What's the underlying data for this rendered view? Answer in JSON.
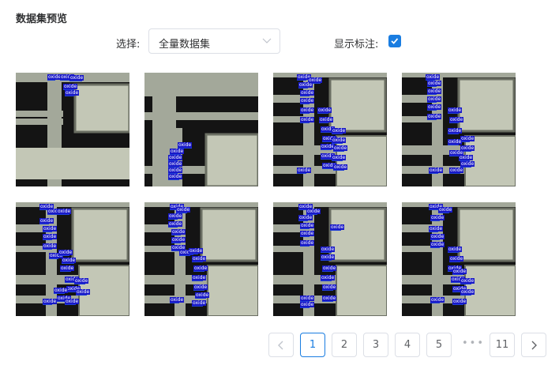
{
  "page": {
    "title": "数据集预览"
  },
  "toolbar": {
    "select_label": "选择:",
    "select_value": "全量数据集",
    "annotation_label": "显示标注:",
    "annotation_checked": true,
    "accent_color": "#1a7de1"
  },
  "gallery": {
    "annotation_class": "oxide",
    "box_color": "#1818c8"
  },
  "pagination": {
    "pages": [
      "1",
      "2",
      "3",
      "4",
      "5"
    ],
    "ellipsis": "•••",
    "last_page": "11",
    "current": "1",
    "prev_icon": "chevron-left-icon",
    "next_icon": "chevron-right-icon"
  }
}
